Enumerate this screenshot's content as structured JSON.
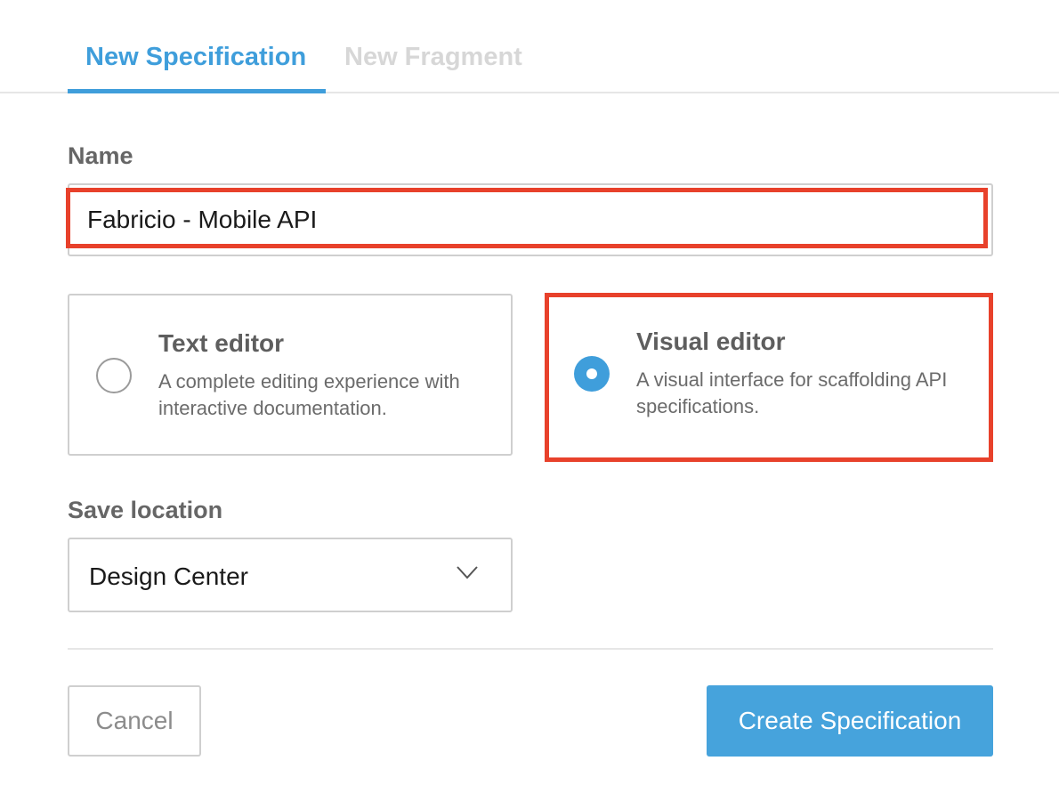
{
  "tabs": [
    {
      "label": "New Specification",
      "active": true
    },
    {
      "label": "New Fragment",
      "active": false
    }
  ],
  "name_field": {
    "label": "Name",
    "value": "Fabricio - Mobile API"
  },
  "editors": [
    {
      "title": "Text editor",
      "description": "A complete editing experience with interactive documentation.",
      "selected": false
    },
    {
      "title": "Visual editor",
      "description": "A visual interface for scaffolding API specifications.",
      "selected": true
    }
  ],
  "save_location": {
    "label": "Save location",
    "selected": "Design Center",
    "icon": "chevron-down-icon"
  },
  "buttons": {
    "cancel_label": "Cancel",
    "create_label": "Create Specification"
  },
  "colors": {
    "accent": "#3f9edb",
    "primary_button": "#46a3dc",
    "highlight": "#e8412b",
    "inactive_tab": "#d7d7d7"
  }
}
